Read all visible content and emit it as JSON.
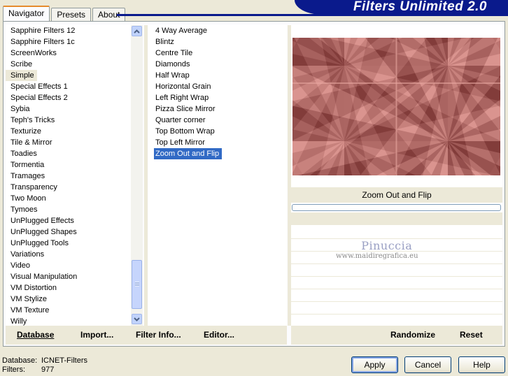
{
  "window": {
    "banner_title": "Filters Unlimited 2.0"
  },
  "tabs": [
    {
      "label": "Navigator",
      "active": true
    },
    {
      "label": "Presets",
      "active": false
    },
    {
      "label": "About",
      "active": false
    }
  ],
  "categories": {
    "items": [
      "Sapphire Filters 12",
      "Sapphire Filters 1c",
      "ScreenWorks",
      "Scribe",
      "Simple",
      "Special Effects 1",
      "Special Effects 2",
      "Sybia",
      "Teph's Tricks",
      "Texturize",
      "Tile & Mirror",
      "Toadies",
      "Tormentia",
      "Tramages",
      "Transparency",
      "Two Moon",
      "Tymoes",
      "UnPlugged Effects",
      "UnPlugged Shapes",
      "UnPlugged Tools",
      "Variations",
      "Video",
      "Visual Manipulation",
      "VM Distortion",
      "VM Stylize",
      "VM Texture",
      "Willy"
    ],
    "selected": "Simple"
  },
  "filters": {
    "items": [
      "4 Way Average",
      "Blintz",
      "Centre Tile",
      "Diamonds",
      "Half Wrap",
      "Horizontal Grain",
      "Left Right Wrap",
      "Pizza Slice Mirror",
      "Quarter corner",
      "Top Bottom Wrap",
      "Top Left Mirror",
      "Zoom Out and Flip"
    ],
    "selected": "Zoom Out and Flip"
  },
  "preview": {
    "caption": "Zoom Out and Flip",
    "colors": {
      "light": "#e8a7a0",
      "dark": "#6e2b2b",
      "mid": "#b86a66"
    }
  },
  "watermark": {
    "name": "Pinuccia",
    "url": "www.maidiregrafica.eu"
  },
  "left_buttons": {
    "database": "Database",
    "import": "Import...",
    "filter_info": "Filter Info...",
    "editor": "Editor..."
  },
  "right_buttons": {
    "randomize": "Randomize",
    "reset": "Reset"
  },
  "info": {
    "database_label": "Database:",
    "database_value": "ICNET-Filters",
    "filters_label": "Filters:",
    "filters_value": "977"
  },
  "dialog_buttons": {
    "apply": "Apply",
    "cancel": "Cancel",
    "help": "Help"
  }
}
